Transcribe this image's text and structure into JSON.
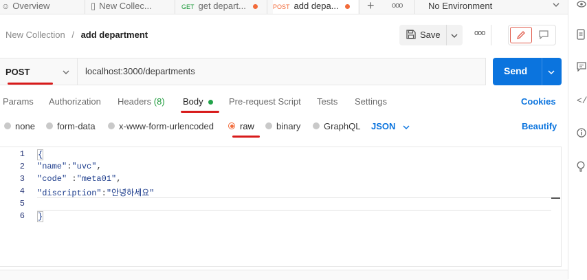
{
  "tabs": [
    {
      "label": "Overview"
    },
    {
      "label": "New Collec..."
    },
    {
      "method": "GET",
      "label": "get depart..."
    },
    {
      "method": "POST",
      "label": "add depa..."
    }
  ],
  "environment": {
    "label": "No Environment"
  },
  "breadcrumb": {
    "collection": "New Collection",
    "separator": "/",
    "request": "add department"
  },
  "header": {
    "save_label": "Save",
    "more": "ooo"
  },
  "request": {
    "method": "POST",
    "url": "localhost:3000/departments",
    "send_label": "Send"
  },
  "subtabs": {
    "params": "Params",
    "authorization": "Authorization",
    "headers": "Headers",
    "headers_count": "(8)",
    "body": "Body",
    "prerequest": "Pre-request Script",
    "tests": "Tests",
    "settings": "Settings",
    "cookies": "Cookies"
  },
  "body_types": {
    "none": "none",
    "form_data": "form-data",
    "urlencoded": "x-www-form-urlencoded",
    "raw": "raw",
    "binary": "binary",
    "graphql": "GraphQL",
    "format": "JSON",
    "beautify": "Beautify"
  },
  "editor": {
    "line_numbers": [
      "1",
      "2",
      "3",
      "4",
      "5",
      "6"
    ],
    "line1": "{",
    "line2_key": "\"name\"",
    "line2_sep": ":",
    "line2_val": "\"uvc\"",
    "line2_end": ",",
    "line3_key": "\"code\"",
    "line3_sep": " :",
    "line3_val": "\"meta01\"",
    "line3_end": ",",
    "line4_key": "\"discription\"",
    "line4_sep": ":",
    "line4_val": "\"안녕하세요\"",
    "line6": "}"
  },
  "colors": {
    "accent": "#0b74de",
    "post": "#f26b3a",
    "get": "#1c9a3a",
    "annotation": "#d81b1b"
  }
}
